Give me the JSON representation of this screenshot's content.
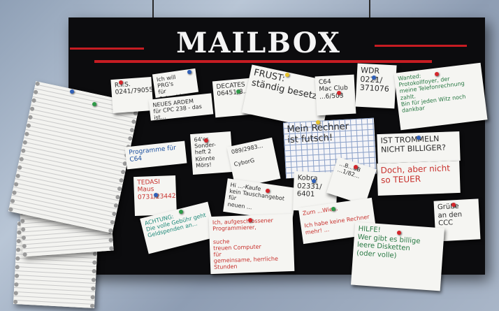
{
  "title": "MAILBOX",
  "notes": {
    "ris": "R.I.S.\n0241/790555",
    "ichwill": "Ich will PRG's\nfür Schneider",
    "neues": "NEUES ARDEM\nfür CPC 238 - das ist...",
    "decates": "DECATES\n06451/8...",
    "frust": "FRUST:\nständig besetzt!",
    "c64club": "C64\nMac Club\n...6/503",
    "wdr": "WDR\n0221/\n371076",
    "wanted": "Wanted:\nProtokollfoyer, der\nmeine Telefonrechnung\nzahlt.\nBin für jeden Witz noch dankbar",
    "programme": "Programme für\nC64",
    "mein_rechner": "Mein Rechner\nist futsch!",
    "trommeln_q": "IST TROMMELN\nNICHT BILLIGER?",
    "trommeln_a": "Doch, aber nicht\nso TEUER",
    "sonderheft": "64'er Sonder-\nheft 2\nKönnte\nMörs!",
    "cyborg": "089/2983...\n\nCyborG",
    "tedasi": "TEDASI\nMaus\n0731/234422",
    "verkauf": "Hi ...-Kaufe\nkein Tauschangebot für\nneuen ...",
    "kobra": "Kobra\n02331/\n6401",
    "kabel": "...B...0B\n...1/82...",
    "achtung": "ACHTUNG:\nDie volle Gebühr geht\nGeldspenden an...",
    "suche": "Ich, aufgeschlossener\nProgrammierer,\n\nsuche\ntreuen Computer\nfür\ngemeinsame, herrliche\nStunden",
    "kein_rechner": "Zum ...Wie...\n\nIch habe keine Rechner\nmehr! ...",
    "gruss": "Grüße\nan den\nCCC",
    "hilfe": "HILFE!\nWer gibt es billige\nleere Disketten\n(oder volle)"
  },
  "colors": {
    "board": "#0c0c0e",
    "stripe": "#c61c22",
    "title": "#f4f4f4"
  }
}
